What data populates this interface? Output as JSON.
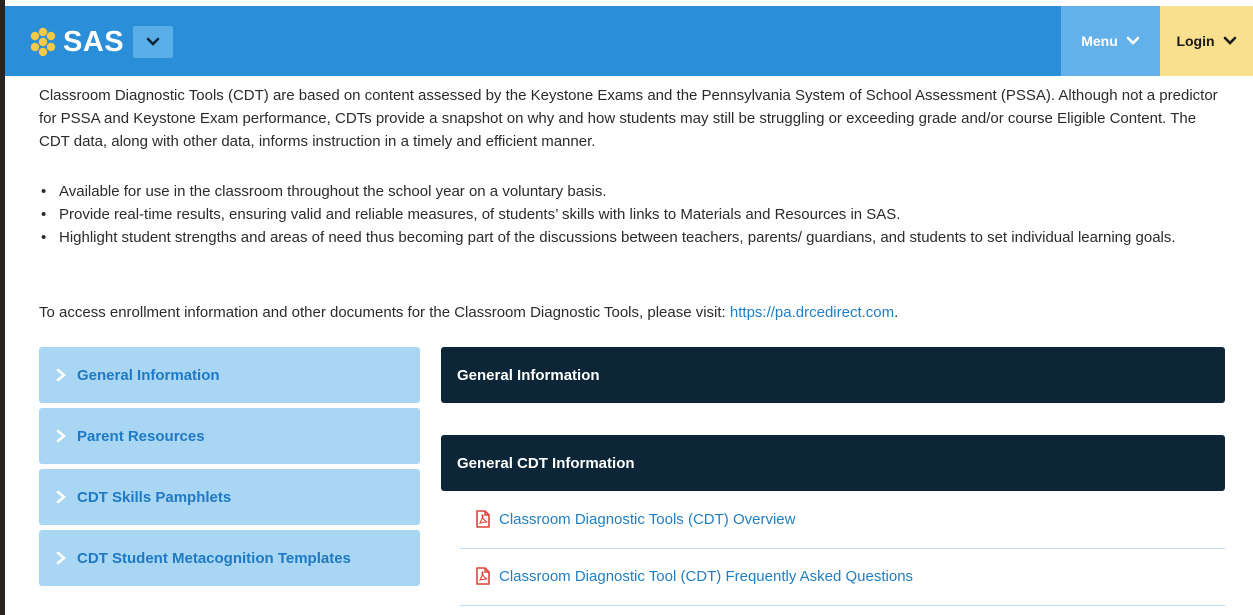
{
  "header": {
    "logo_text": "SAS",
    "menu_label": "Menu",
    "login_label": "Login",
    "colors": {
      "bar": "#2a8fd8",
      "menu": "#62b1ea",
      "login": "#f9e08e",
      "logo_flower": "#f7c948"
    }
  },
  "intro": {
    "paragraph": "Classroom Diagnostic Tools (CDT) are based on content assessed by the Keystone Exams and the Pennsylvania System of School Assessment (PSSA). Although not a predictor for PSSA and Keystone Exam performance, CDTs provide a snapshot on why and how students may still be struggling or exceeding grade and/or course Eligible Content. The CDT data, along with other data, informs instruction in a timely and efficient manner.",
    "bullets": [
      "Available for use in the classroom throughout the school year on a voluntary basis.",
      "Provide real-time results, ensuring valid and reliable measures, of students’ skills with links to Materials and Resources in SAS.",
      "Highlight student strengths and areas of need thus becoming part of the discussions between teachers, parents/ guardians, and students to set individual learning goals."
    ],
    "access_text": "To access enrollment information and other documents for the Classroom Diagnostic Tools, please visit: ",
    "access_link": "https://pa.drcedirect.com",
    "access_end": "."
  },
  "sidebar": {
    "items": [
      {
        "label": "General Information"
      },
      {
        "label": "Parent Resources"
      },
      {
        "label": "CDT Skills Pamphlets"
      },
      {
        "label": "CDT Student Metacognition Templates"
      }
    ]
  },
  "main": {
    "section_title": "General Information",
    "subsection_title": "General CDT Information",
    "documents": [
      {
        "label": "Classroom Diagnostic Tools (CDT) Overview",
        "icon": "pdf-icon"
      },
      {
        "label": "Classroom Diagnostic Tool (CDT) Frequently Asked Questions",
        "icon": "pdf-icon"
      }
    ]
  }
}
